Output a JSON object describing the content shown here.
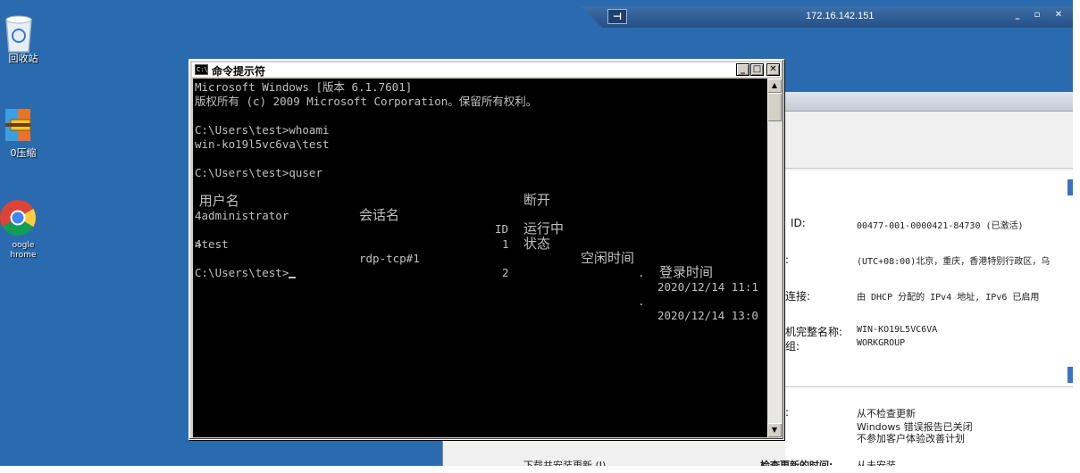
{
  "desktop": {
    "icons": [
      {
        "label": "回收站"
      },
      {
        "label": "0压缩"
      },
      {
        "label": "oogle\nhrome"
      }
    ]
  },
  "remote_bar": {
    "host_ip": "172.16.142.151",
    "pin_glyph": "⊣",
    "minimize": "_",
    "restore": "▫",
    "close": "✕"
  },
  "cmd_window": {
    "title": "命令提示符",
    "minimize": "_",
    "maximize": "□",
    "close": "✕",
    "lines": {
      "l1": "Microsoft Windows [版本 6.1.7601]",
      "l2": "版权所有 (c) 2009 Microsoft Corporation。保留所有权利。",
      "l3": "C:\\Users\\test>whoami",
      "l4": "win-ko19l5vc6va\\test",
      "l5": "C:\\Users\\test>quser",
      "l6": "4",
      "l7": "4",
      "l8": "C:\\Users\\test>"
    },
    "quser": {
      "headers": {
        "user": " 用户名",
        "session": "会话名",
        "id": "ID",
        "state": "状态",
        "idle": "空闲时间",
        "logon": "登录时间"
      },
      "rows": [
        {
          "user": " administrator",
          "session": "",
          "id": "1",
          "state": "断开",
          "idle": ".",
          "logon": "2020/12/14 11:1"
        },
        {
          "user": ">test",
          "session": "rdp-tcp#1",
          "id": "2",
          "state": "运行中",
          "idle": ".",
          "logon": "2020/12/14 13:0"
        }
      ]
    }
  },
  "system_properties": {
    "product_id_label": "ID:",
    "product_id_value": "00477-001-0000421-84730 (已激活)",
    "timezone_label": ":",
    "timezone_value": "(UTC+08:00)北京，重庆，香港特别行政区，乌",
    "connection_label": "连接:",
    "connection_value": "由 DHCP 分配的 IPv4 地址, IPv6 已启用",
    "fullname_label": "机完整名称:",
    "fullname_value": "WIN-KO19L5VC6VA",
    "workgroup_label": "组:",
    "workgroup_value": "WORKGROUP",
    "update_label": ":",
    "update_value": "从不检查更新",
    "error_value": "Windows 错误报告已关闭",
    "ceip_value": "不参加客户体验改善计划",
    "bottom_left": "下载并安装更新 (I)",
    "bottom_mid": "检查更新的时间:",
    "bottom_right": "从未安装"
  }
}
